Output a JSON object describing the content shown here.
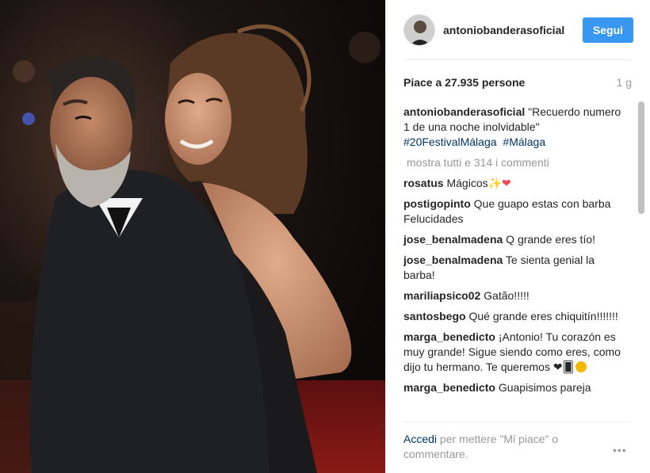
{
  "post": {
    "username": "antoniobanderasoficial",
    "follow_label": "Segui",
    "likes_text": "Piace a 27.935 persone",
    "time_ago": "1 g",
    "caption": {
      "username": "antoniobanderasoficial",
      "text": "\"Recuerdo numero 1 de una noche inolvidable\"",
      "tags": [
        "#20FestivalMálaga",
        "#Málaga"
      ]
    },
    "show_all_comments": "mostra tutti e 314 i commenti",
    "comments": [
      {
        "user": "rosatus",
        "text": "Mágicos✨",
        "emoji": "❤"
      },
      {
        "user": "postigopinto",
        "text": "Que guapo estas con barba Felucidades"
      },
      {
        "user": "jose_benalmadena",
        "text": "Q grande eres tío!"
      },
      {
        "user": "jose_benalmadena",
        "text": "Te sienta genial la barba!"
      },
      {
        "user": "mariliapsico02",
        "text": "Gatão!!!!!"
      },
      {
        "user": "santosbego",
        "text": "Qué grande eres chiquitín!!!!!!!"
      },
      {
        "user": "marga_benedicto",
        "text": "¡Antonio! Tu corazón es muy grande! Sigue siendo como eres, como dijo tu hermano. Te queremos ❤🂠"
      },
      {
        "user": "marga_benedicto",
        "text": "Guapisimos pareja"
      }
    ],
    "footer": {
      "link_text": "Accedi",
      "rest_text": "per mettere \"Mi piace\" o commentare."
    },
    "more_options_icon": "ellipsis-icon"
  },
  "colors": {
    "accent": "#3897f0",
    "hashtag": "#003569",
    "muted": "#999999",
    "heart": "#ed4956"
  }
}
